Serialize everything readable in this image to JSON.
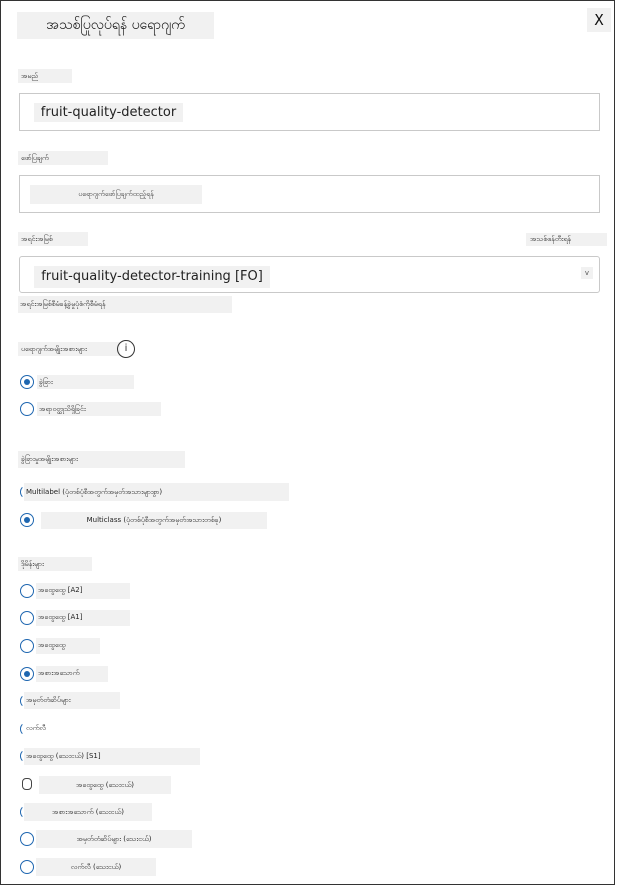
{
  "dialog": {
    "title": "အသစ်ပြုလုပ်ရန် ပရောဂျက်",
    "close_label": "X"
  },
  "form": {
    "name_label": "အမည်",
    "name_value": "fruit-quality-detector",
    "description_label": "ဖော်ပြချက်",
    "description_placeholder": "ပရောဂျက်ဖော်ပြချက်ထည့်ရန်",
    "resource_label": "အရင်းအမြစ်",
    "create_resource_link": "အသစ်ဖန်တီးရန်",
    "resource_value": "fruit-quality-detector-training [FO]",
    "resource_chevron": "v",
    "resource_help": "အရင်းအမြစ်စီမံခန့်ခွဲမှုပုံစံကိုစီမံရန်"
  },
  "project_types": {
    "label": "ပရောဂျက်အမျိုးအစားများ",
    "info_icon_label": "i",
    "options": [
      {
        "label": "ခွဲခြား",
        "selected": true
      },
      {
        "label": "အရာဝတ္ထုသိရှိခြင်း",
        "selected": false
      }
    ]
  },
  "classification_types": {
    "label": "ခွဲခြားမှုအမျိုးအစားများ",
    "options": [
      {
        "label": "Multilabel (ပုံတစ်ပုံစီအတွက်အမှတ်အသားများစွာ)",
        "selected": false
      },
      {
        "label": "Multiclass (ပုံတစ်ပုံစီအတွက်အမှတ်အသားတစ်ခု)",
        "selected": true
      }
    ]
  },
  "domains": {
    "label": "ဒိုမိန်းများ",
    "options": [
      {
        "label": "အထွေထွေ [A2]",
        "selected": false
      },
      {
        "label": "အထွေထွေ [A1]",
        "selected": false
      },
      {
        "label": "အထွေထွေ",
        "selected": false
      },
      {
        "label": "အစားအသောက်",
        "selected": true
      },
      {
        "label": "အမှတ်တံဆိပ်များ",
        "selected": false
      },
      {
        "label": "လက်လီ",
        "selected": false
      },
      {
        "label": "အထွေထွေ (သေးငယ်) [S1]",
        "selected": false
      },
      {
        "label": "အထွေထွေ (သေးငယ်)",
        "selected": false
      },
      {
        "label": "အစားအသောက် (သေးငယ်)",
        "selected": false
      },
      {
        "label": "အမှတ်တံဆိပ်များ (သေးငယ်)",
        "selected": false
      },
      {
        "label": "လက်လီ (သေးငယ်)",
        "selected": false
      }
    ]
  }
}
